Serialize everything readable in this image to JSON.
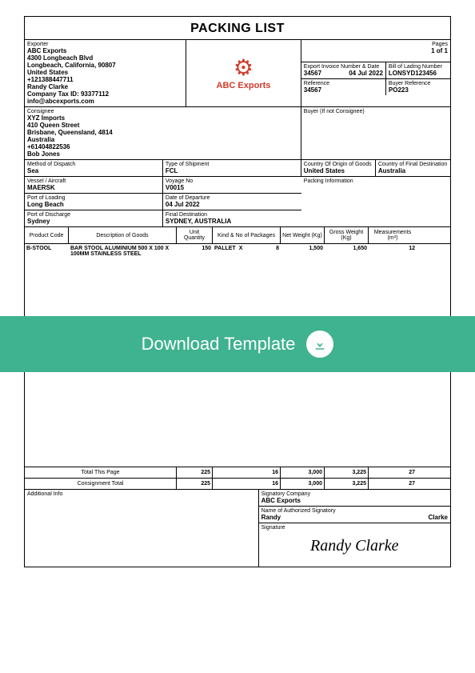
{
  "title": "PACKING LIST",
  "pages": {
    "label": "Pages",
    "value": "1 of 1"
  },
  "exporter": {
    "label": "Exporter",
    "name": "ABC Exports",
    "addr1": "4300 Longbeach Blvd",
    "addr2": "Longbeach, California, 90807",
    "country": "United States",
    "phone": "+121388447711",
    "contact": "Randy Clarke",
    "tax": "Company Tax ID: 93377112",
    "email": "info@abcexports.com"
  },
  "logo": {
    "text": "ABC Exports"
  },
  "invoice": {
    "label": "Export Invoice Number & Date",
    "num": "34567",
    "date": "04 Jul 2022"
  },
  "bol": {
    "label": "Bill of Lading Number",
    "value": "LONSYD123456"
  },
  "reference": {
    "label": "Reference",
    "value": "34567"
  },
  "buyerRef": {
    "label": "Buyer Reference",
    "value": "PO223"
  },
  "consignee": {
    "label": "Consignee",
    "name": "XYZ Imports",
    "addr1": "410 Queen Street",
    "addr2": "Brisbane, Queensland, 4814",
    "country": "Australia",
    "phone": "+61404822536",
    "contact": "Bob Jones"
  },
  "buyer": {
    "label": "Buyer (If not Consignee)"
  },
  "dispatch": {
    "label": "Method of Dispatch",
    "value": "Sea"
  },
  "shipType": {
    "label": "Type of Shipment",
    "value": "FCL"
  },
  "origin": {
    "label": "Country Of Origin of Goods",
    "value": "United States"
  },
  "finalDestCountry": {
    "label": "Country of Final Destination",
    "value": "Australia"
  },
  "vessel": {
    "label": "Vessel / Aircraft",
    "value": "MAERSK"
  },
  "voyage": {
    "label": "Voyage No",
    "value": "V0015"
  },
  "packingInfo": {
    "label": "Packing Information"
  },
  "portLoad": {
    "label": "Port of Loading",
    "value": "Long Beach"
  },
  "dateDep": {
    "label": "Date of Departure",
    "value": "04 Jul 2022"
  },
  "portDisch": {
    "label": "Port of Discharge",
    "value": "Sydney"
  },
  "finalDest": {
    "label": "Final Destination",
    "value": "SYDNEY, AUSTRALIA"
  },
  "columns": {
    "code": "Product Code",
    "desc": "Description of Goods",
    "qty": "Unit Quantity",
    "kind": "Kind & No of Packages",
    "net": "Net Weight (Kg)",
    "gross": "Gross Weight (Kg)",
    "meas": "Measurements (m³)"
  },
  "lines": [
    {
      "code": "B-STOOL",
      "desc": "BAR STOOL ALUMINIUM 500 X 100 X 100MM STAINLESS STEEL",
      "qty": "150",
      "kind": "PALLET",
      "x": "X",
      "pkgs": "8",
      "net": "1,500",
      "gross": "1,650",
      "meas": "12"
    }
  ],
  "totals": {
    "pageLabel": "Total This Page",
    "consLabel": "Consignment Total",
    "page": {
      "qty": "225",
      "pkgs": "16",
      "net": "3,000",
      "gross": "3,225",
      "meas": "27"
    },
    "cons": {
      "qty": "225",
      "pkgs": "16",
      "net": "3,000",
      "gross": "3,225",
      "meas": "27"
    }
  },
  "additional": {
    "label": "Additional Info"
  },
  "sigCompany": {
    "label": "Signatory Company",
    "value": "ABC Exports"
  },
  "sigName": {
    "label": "Name of Authorized Signatory",
    "first": "Randy",
    "last": "Clarke"
  },
  "signature": {
    "label": "Signature",
    "value": "Randy Clarke"
  },
  "banner": "Download Template"
}
